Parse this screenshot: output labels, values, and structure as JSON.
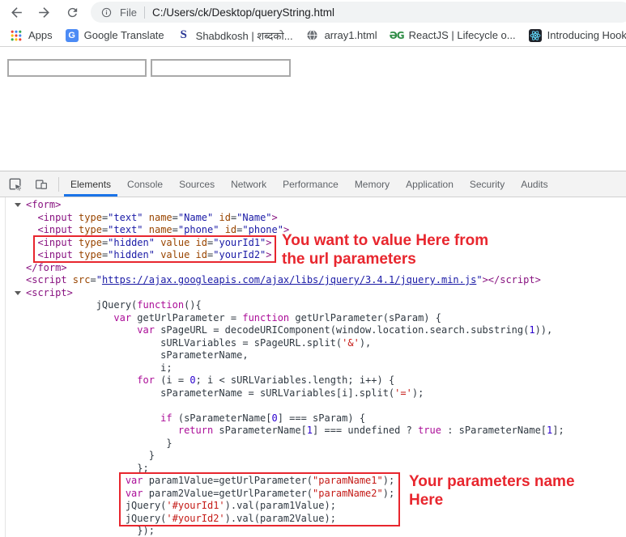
{
  "browser": {
    "toolbar_icons": [
      "back-arrow",
      "forward-arrow",
      "reload",
      "page-info"
    ],
    "address": {
      "scheme_label": "File",
      "path": "C:/Users/ck/Desktop/queryString.html"
    },
    "bookmarks": [
      {
        "icon": "apps-grid",
        "label": "Apps"
      },
      {
        "icon": "google-translate",
        "label": "Google Translate"
      },
      {
        "icon": "letter-s",
        "label": "Shabdkosh | शब्दको..."
      },
      {
        "icon": "globe",
        "label": "array1.html"
      },
      {
        "icon": "geeksforgeeks",
        "label": "ReactJS | Lifecycle o..."
      },
      {
        "icon": "react-logo",
        "label": "Introducing Hooks..."
      }
    ]
  },
  "page": {
    "inputs": [
      {
        "value": ""
      },
      {
        "value": ""
      }
    ]
  },
  "devtools": {
    "toolbar_icons": [
      "inspect-cursor",
      "toggle-device-toolbar"
    ],
    "tabs": [
      {
        "label": "Elements",
        "active": true
      },
      {
        "label": "Console"
      },
      {
        "label": "Sources"
      },
      {
        "label": "Network"
      },
      {
        "label": "Performance"
      },
      {
        "label": "Memory"
      },
      {
        "label": "Application"
      },
      {
        "label": "Security"
      },
      {
        "label": "Audits"
      }
    ],
    "annotations": {
      "accent_color": "#e8262e",
      "note1_line1": "You want to value Here from",
      "note1_line2": "the url parameters",
      "note2_line1": "Your parameters name",
      "note2_line2": "Here"
    },
    "code": {
      "colors": {
        "tag": "#881280",
        "attribute": "#994500",
        "attribute_value": "#1a1aa6",
        "keyword": "#ab0d98",
        "string": "#c41a16",
        "number": "#2a00cf",
        "plain": "#303942"
      },
      "lines": [
        {
          "a": 1,
          "t": [
            [
              "tag",
              "<form>"
            ]
          ]
        },
        {
          "i": 2,
          "t": [
            [
              "tag",
              "<input"
            ],
            [
              "attr",
              " type"
            ],
            [
              "plain",
              "="
            ],
            [
              "val",
              "\"text\""
            ],
            [
              "attr",
              " name"
            ],
            [
              "plain",
              "="
            ],
            [
              "val",
              "\"Name\""
            ],
            [
              "attr",
              " id"
            ],
            [
              "plain",
              "="
            ],
            [
              "val",
              "\"Name\""
            ],
            [
              "tag",
              ">"
            ]
          ]
        },
        {
          "i": 2,
          "t": [
            [
              "tag",
              "<input"
            ],
            [
              "attr",
              " type"
            ],
            [
              "plain",
              "="
            ],
            [
              "val",
              "\"text\""
            ],
            [
              "attr",
              " name"
            ],
            [
              "plain",
              "="
            ],
            [
              "val",
              "\"phone\""
            ],
            [
              "attr",
              " id"
            ],
            [
              "plain",
              "="
            ],
            [
              "val",
              "\"phone\""
            ],
            [
              "tag",
              ">"
            ]
          ]
        },
        {
          "i": 2,
          "t": [
            [
              "tag",
              "<input"
            ],
            [
              "attr",
              " type"
            ],
            [
              "plain",
              "="
            ],
            [
              "val",
              "\"hidden\""
            ],
            [
              "attr",
              " value"
            ],
            [
              "attr",
              " id"
            ],
            [
              "plain",
              "="
            ],
            [
              "val",
              "\"yourId1\""
            ],
            [
              "tag",
              ">"
            ]
          ]
        },
        {
          "i": 2,
          "t": [
            [
              "tag",
              "<input"
            ],
            [
              "attr",
              " type"
            ],
            [
              "plain",
              "="
            ],
            [
              "val",
              "\"hidden\""
            ],
            [
              "attr",
              " value"
            ],
            [
              "attr",
              " id"
            ],
            [
              "plain",
              "="
            ],
            [
              "val",
              "\"yourId2\""
            ],
            [
              "tag",
              ">"
            ]
          ]
        },
        {
          "t": [
            [
              "tag",
              "</form>"
            ]
          ]
        },
        {
          "t": [
            [
              "tag",
              "<script"
            ],
            [
              "attr",
              " src"
            ],
            [
              "plain",
              "="
            ],
            [
              "val",
              "\""
            ],
            [
              "link",
              "https://ajax.googleapis.com/ajax/libs/jquery/3.4.1/jquery.min.js"
            ],
            [
              "val",
              "\""
            ],
            [
              "tag",
              "></script>"
            ]
          ]
        },
        {
          "a": 1,
          "t": [
            [
              "tag",
              "<script>"
            ]
          ]
        },
        {
          "i": 12,
          "t": [
            [
              "plain",
              "jQuery("
            ],
            [
              "kw",
              "function"
            ],
            [
              "plain",
              "(){"
            ]
          ]
        },
        {
          "i": 15,
          "t": [
            [
              "kw",
              "var"
            ],
            [
              "plain",
              " getUrlParameter = "
            ],
            [
              "kw",
              "function"
            ],
            [
              "plain",
              " getUrlParameter(sParam) {"
            ]
          ]
        },
        {
          "i": 19,
          "t": [
            [
              "kw",
              "var"
            ],
            [
              "plain",
              " sPageURL = decodeURIComponent(window.location.search.substring("
            ],
            [
              "num",
              "1"
            ],
            [
              "plain",
              ")),"
            ]
          ]
        },
        {
          "i": 23,
          "t": [
            [
              "plain",
              "sURLVariables = sPageURL.split("
            ],
            [
              "str",
              "'&'"
            ],
            [
              "plain",
              "),"
            ]
          ]
        },
        {
          "i": 23,
          "t": [
            [
              "plain",
              "sParameterName,"
            ]
          ]
        },
        {
          "i": 23,
          "t": [
            [
              "plain",
              "i;"
            ]
          ]
        },
        {
          "i": 19,
          "t": [
            [
              "kw",
              "for"
            ],
            [
              "plain",
              " (i = "
            ],
            [
              "num",
              "0"
            ],
            [
              "plain",
              "; i < sURLVariables.length; i++) {"
            ]
          ]
        },
        {
          "i": 23,
          "t": [
            [
              "plain",
              "sParameterName = sURLVariables[i].split("
            ],
            [
              "str",
              "'='"
            ],
            [
              "plain",
              ");"
            ]
          ]
        },
        {
          "t": []
        },
        {
          "i": 23,
          "t": [
            [
              "kw",
              "if"
            ],
            [
              "plain",
              " (sParameterName["
            ],
            [
              "num",
              "0"
            ],
            [
              "plain",
              "] === sParam) {"
            ]
          ]
        },
        {
          "i": 26,
          "t": [
            [
              "kw",
              "return"
            ],
            [
              "plain",
              " sParameterName["
            ],
            [
              "num",
              "1"
            ],
            [
              "plain",
              "] === undefined ? "
            ],
            [
              "kw",
              "true"
            ],
            [
              "plain",
              " : sParameterName["
            ],
            [
              "num",
              "1"
            ],
            [
              "plain",
              "];"
            ]
          ]
        },
        {
          "i": 24,
          "t": [
            [
              "plain",
              "}"
            ]
          ]
        },
        {
          "i": 21,
          "t": [
            [
              "plain",
              "}"
            ]
          ]
        },
        {
          "i": 19,
          "t": [
            [
              "plain",
              "};"
            ]
          ]
        },
        {
          "i": 17,
          "t": [
            [
              "kw",
              "var"
            ],
            [
              "plain",
              " param1Value=getUrlParameter("
            ],
            [
              "str",
              "\"paramName1\""
            ],
            [
              "plain",
              ");"
            ]
          ]
        },
        {
          "i": 17,
          "t": [
            [
              "kw",
              "var"
            ],
            [
              "plain",
              " param2Value=getUrlParameter("
            ],
            [
              "str",
              "\"paramName2\""
            ],
            [
              "plain",
              ");"
            ]
          ]
        },
        {
          "i": 17,
          "t": [
            [
              "plain",
              "jQuery("
            ],
            [
              "str",
              "'#yourId1'"
            ],
            [
              "plain",
              ").val(param1Value);"
            ]
          ]
        },
        {
          "i": 17,
          "t": [
            [
              "plain",
              "jQuery("
            ],
            [
              "str",
              "'#yourId2'"
            ],
            [
              "plain",
              ").val(param2Value);"
            ]
          ]
        },
        {
          "i": 19,
          "t": [
            [
              "plain",
              "});"
            ]
          ]
        }
      ]
    }
  }
}
